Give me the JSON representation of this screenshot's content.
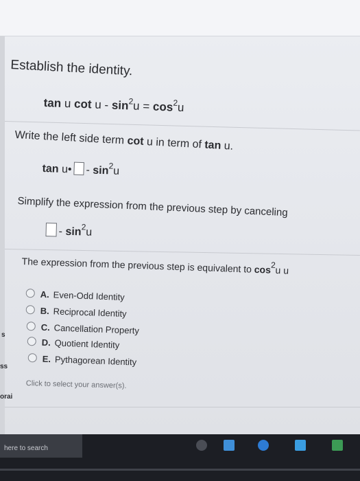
{
  "heading": "Establish the identity.",
  "identity": {
    "tan": "tan",
    "u1": "u",
    "cot": "cot",
    "u2": "u",
    "minus": "-",
    "sin": "sin",
    "exp": "2",
    "u3": "u",
    "equals": "=",
    "cos": "cos",
    "exp2": "2",
    "u4": "u"
  },
  "step1": {
    "text1": "Write the left side term",
    "cot": "cot",
    "u": "u",
    "text2": "in term of",
    "tan": "tan",
    "u2": "u."
  },
  "step1_expr": {
    "tan": "tan",
    "u": "u",
    "dot": "•",
    "minus": "-",
    "sin": "sin",
    "exp": "2",
    "u2": "u"
  },
  "step2": {
    "text": "Simplify the expression from the previous step by canceling"
  },
  "step2_expr": {
    "minus": "-",
    "sin": "sin",
    "exp": "2",
    "u": "u"
  },
  "step3": {
    "text": "The expression from the previous step is equivalent to",
    "cos": "cos",
    "exp": "2",
    "u": "u",
    "trail": "u"
  },
  "options": [
    {
      "letter": "A.",
      "label": "Even-Odd Identity"
    },
    {
      "letter": "B.",
      "label": "Reciprocal Identity"
    },
    {
      "letter": "C.",
      "label": "Cancellation Property"
    },
    {
      "letter": "D.",
      "label": "Quotient Identity"
    },
    {
      "letter": "E.",
      "label": "Pythagorean Identity"
    }
  ],
  "hint": "Click to select your answer(s).",
  "edge_texts": [
    "s",
    "ss",
    "orai"
  ],
  "taskbar": {
    "search_text": "here to search"
  }
}
